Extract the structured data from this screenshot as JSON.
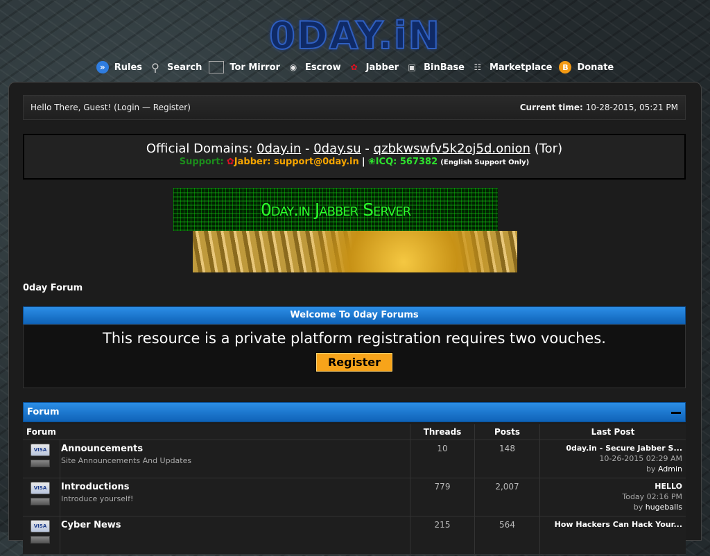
{
  "site": {
    "logo": "0DAY.iN"
  },
  "nav": [
    {
      "label": "Rules",
      "icon": "rules-icon"
    },
    {
      "label": "Search",
      "icon": "search-icon"
    },
    {
      "label": "Tor Mirror",
      "icon": "tor-icon"
    },
    {
      "label": "Escrow",
      "icon": "money-bag-icon"
    },
    {
      "label": "Jabber",
      "icon": "jabber-icon"
    },
    {
      "label": "BinBase",
      "icon": "bank-icon"
    },
    {
      "label": "Marketplace",
      "icon": "cart-icon"
    },
    {
      "label": "Donate",
      "icon": "bitcoin-icon"
    }
  ],
  "welcome": {
    "greeting": "Hello There, Guest! (",
    "login": "Login",
    "dash": " — ",
    "register": "Register",
    "close": ")",
    "time_label": "Current time:",
    "time_value": "10-28-2015, 05:21 PM"
  },
  "domains": {
    "prefix": "Official Domains: ",
    "d1": "0day.in",
    "sep": " - ",
    "d2": "0day.su",
    "d3": "qzbkwswfv5k2oj5d.onion",
    "tor": " (Tor)",
    "support": "Support:",
    "jabber": "Jabber: support@0day.in",
    "pipe": "|",
    "icq": "ICQ: 567382",
    "english": "(English Support Only)"
  },
  "banner": {
    "title": "0day.in Jabber Server"
  },
  "breadcrumb": "0day Forum",
  "welcome_box": {
    "title": "Welcome To 0day Forums",
    "message": "This resource is a private platform registration requires two vouches.",
    "button": "Register"
  },
  "forum": {
    "title": "Forum",
    "columns": {
      "forum": "Forum",
      "threads": "Threads",
      "posts": "Posts",
      "last_post": "Last Post"
    },
    "rows": [
      {
        "name": "Announcements",
        "desc": "Site Announcements And Updates",
        "threads": "10",
        "posts": "148",
        "lp_title": "0day.in - Secure Jabber S...",
        "lp_date": "10-26-2015 02:29 AM",
        "lp_by": "by",
        "lp_user": "Admin"
      },
      {
        "name": "Introductions",
        "desc": "Introduce yourself!",
        "threads": "779",
        "posts": "2,007",
        "lp_title": "HELLO",
        "lp_date": "Today 02:16 PM",
        "lp_by": "by",
        "lp_user": "hugeballs"
      },
      {
        "name": "Cyber News",
        "desc": "",
        "threads": "215",
        "posts": "564",
        "lp_title": "How Hackers Can Hack Your...",
        "lp_date": "",
        "lp_by": "",
        "lp_user": ""
      }
    ],
    "card_text": "VISA"
  }
}
